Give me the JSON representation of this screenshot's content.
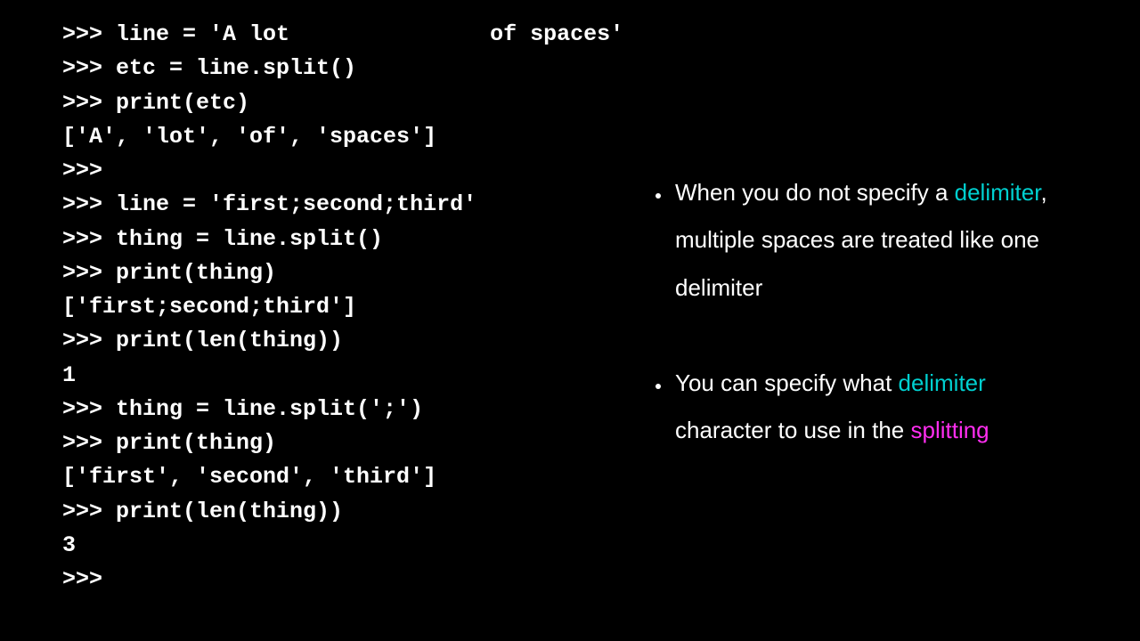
{
  "code_lines": [
    ">>> line = 'A lot               of spaces'",
    ">>> etc = line.split()",
    ">>> print(etc)",
    "['A', 'lot', 'of', 'spaces']",
    ">>>",
    ">>> line = 'first;second;third'",
    ">>> thing = line.split()",
    ">>> print(thing)",
    "['first;second;third']",
    ">>> print(len(thing))",
    "1",
    ">>> thing = line.split(';')",
    ">>> print(thing)",
    "['first', 'second', 'third']",
    ">>> print(len(thing))",
    "3",
    ">>>"
  ],
  "bullets": [
    {
      "pre": "When you do not specify a ",
      "hl1": "delimiter",
      "post1": ", multiple spaces are treated like ",
      "ital": "one",
      "post2": " delimiter"
    },
    {
      "pre": "You can specify what ",
      "hl1": "delimiter",
      "mid": " character to use in the ",
      "hl2": "splitting"
    }
  ],
  "colors": {
    "cyan": "#00d0d0",
    "magenta": "#ff2ef0",
    "bg": "#000000",
    "fg": "#ffffff"
  }
}
